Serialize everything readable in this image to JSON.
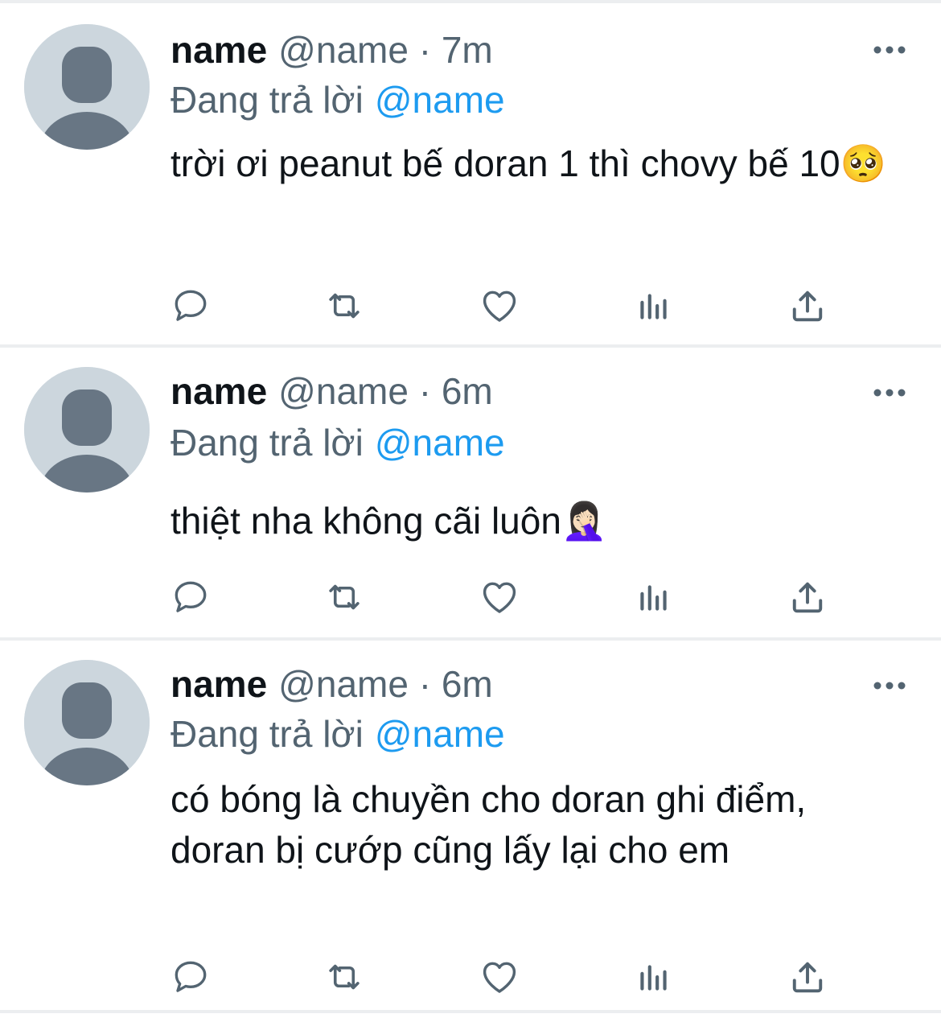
{
  "colors": {
    "text": "#0f1419",
    "muted": "#536471",
    "mention": "#1d9bf0",
    "avatar_bg": "#ccd6dd",
    "avatar_fg": "#687684",
    "divider": "#eceef0"
  },
  "tweets": [
    {
      "display_name": "name",
      "meta": "@name · 7m",
      "reply_prefix": "Đang trả lời",
      "reply_to": "@name",
      "text": "trời ơi peanut bế doran 1 thì chovy bế 10🥺",
      "actions": [
        "reply-icon",
        "retweet-icon",
        "like-icon",
        "analytics-icon",
        "share-icon"
      ]
    },
    {
      "display_name": "name",
      "meta": "@name · 6m",
      "reply_prefix": "Đang trả lời",
      "reply_to": "@name",
      "text": "thiệt nha không cãi luôn🤦🏻‍♀️",
      "actions": [
        "reply-icon",
        "retweet-icon",
        "like-icon",
        "analytics-icon",
        "share-icon"
      ]
    },
    {
      "display_name": "name",
      "meta": "@name · 6m",
      "reply_prefix": "Đang trả lời",
      "reply_to": "@name",
      "text": "có bóng là chuyền cho doran ghi điểm, doran bị cướp cũng lấy lại cho em",
      "actions": [
        "reply-icon",
        "retweet-icon",
        "like-icon",
        "analytics-icon",
        "share-icon"
      ]
    }
  ]
}
